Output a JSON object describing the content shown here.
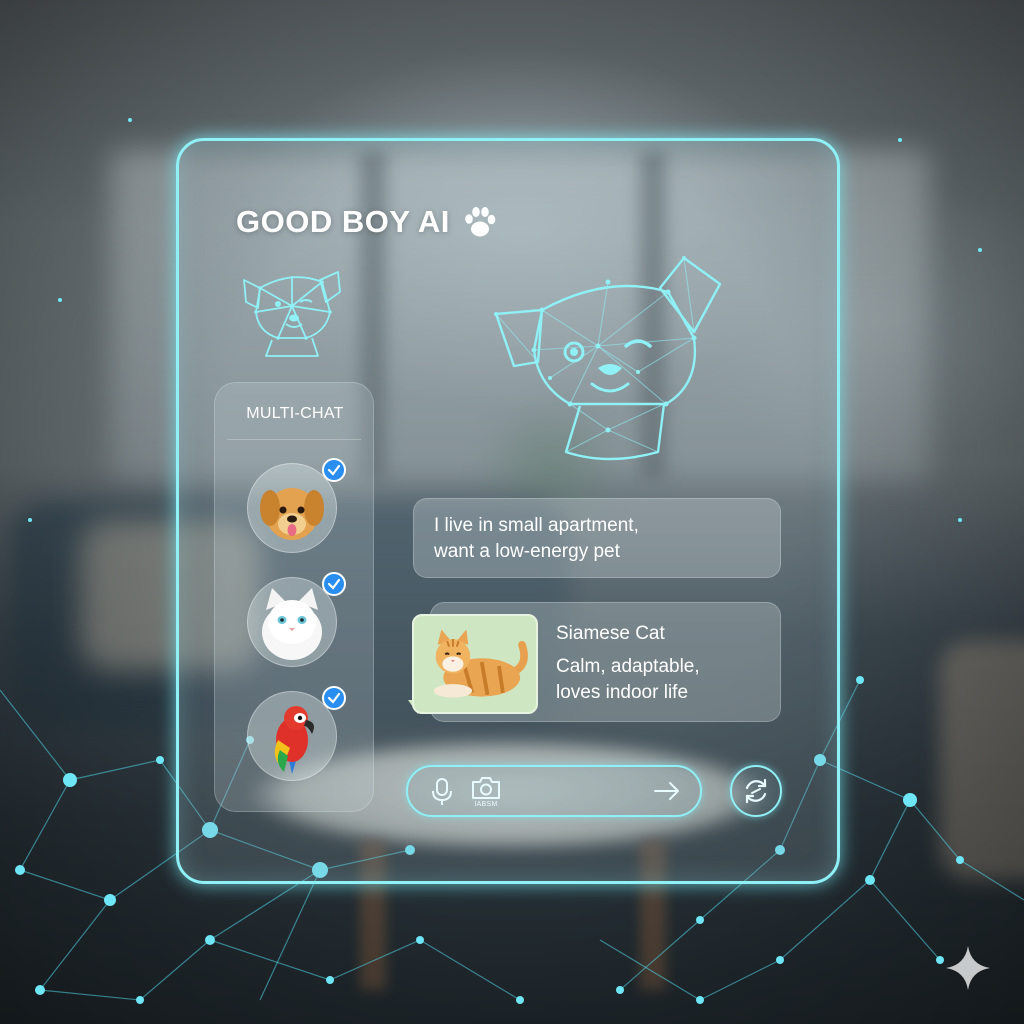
{
  "app": {
    "title": "GOOD BOY AI",
    "title_icon": "paw-print-icon"
  },
  "colors": {
    "accent_glow": "#8ff0f6",
    "check_badge": "#2a8ef0",
    "text": "#ffffff",
    "card_image_bg": "#cfe6c3"
  },
  "sidebar": {
    "title": "MULTI-CHAT",
    "avatars": [
      {
        "pet": "golden-retriever",
        "icon": "dog-avatar-icon",
        "selected": true
      },
      {
        "pet": "white-cat",
        "icon": "cat-avatar-icon",
        "selected": true
      },
      {
        "pet": "parrot",
        "icon": "parrot-avatar-icon",
        "selected": true
      }
    ]
  },
  "chat": {
    "user_message_lines": [
      "I live in small apartment,",
      "want a low-energy pet"
    ],
    "ai_card": {
      "title": "Siamese Cat",
      "description_lines": [
        "Calm, adaptable,",
        "loves indoor life"
      ],
      "image_icon": "cat-lying-icon"
    }
  },
  "input": {
    "mic_icon": "microphone-icon",
    "camera_icon": "camera-icon",
    "camera_label": "IABSM",
    "send_icon": "arrow-right-icon"
  },
  "refresh_icon": "refresh-icon",
  "corner_icon": "sparkle-icon"
}
